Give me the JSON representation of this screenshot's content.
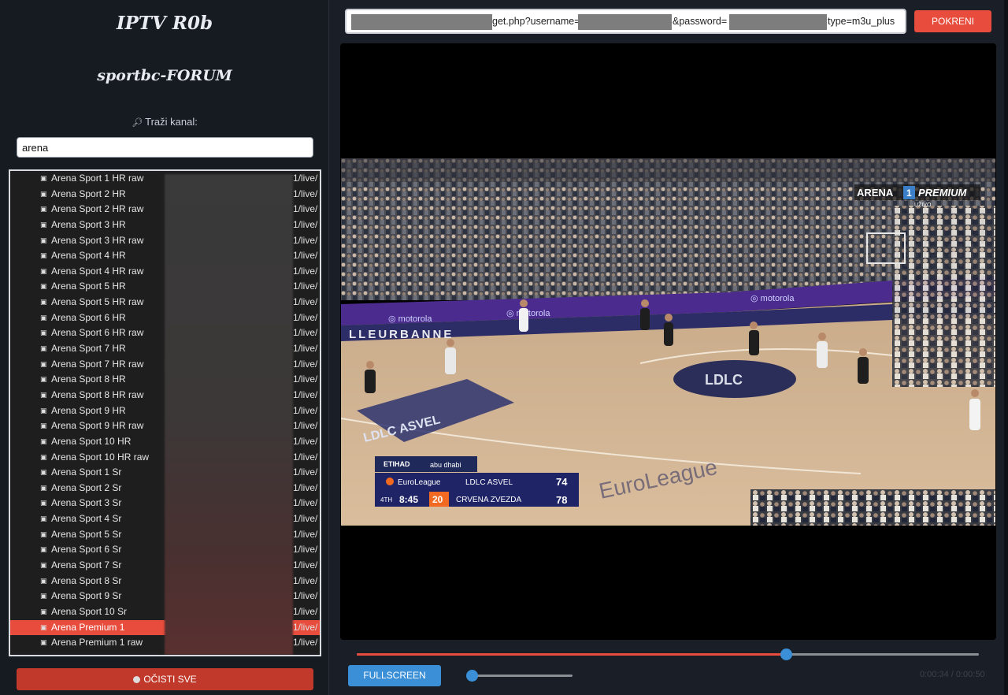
{
  "sidebar": {
    "title": "IPTV R0b",
    "subtitle": "sportbc-FORUM",
    "search_label": "Traži kanal:",
    "search_icon": "magnifier-icon",
    "search_value": "arena",
    "clear_label": "OČISTI SVE",
    "channels": [
      {
        "name": "Arena Sport 1 HR raw",
        "url": "1/live/"
      },
      {
        "name": "Arena Sport 2 HR",
        "url": "1/live/"
      },
      {
        "name": "Arena Sport 2 HR raw",
        "url": "1/live/"
      },
      {
        "name": "Arena Sport 3 HR",
        "url": "1/live/"
      },
      {
        "name": "Arena Sport 3 HR raw",
        "url": "1/live/"
      },
      {
        "name": "Arena Sport 4 HR",
        "url": "1/live/"
      },
      {
        "name": "Arena Sport 4 HR raw",
        "url": "1/live/"
      },
      {
        "name": "Arena Sport 5 HR",
        "url": "1/live/"
      },
      {
        "name": "Arena Sport 5 HR raw",
        "url": "1/live/"
      },
      {
        "name": "Arena Sport 6 HR",
        "url": "1/live/"
      },
      {
        "name": "Arena Sport 6 HR raw",
        "url": "1/live/"
      },
      {
        "name": "Arena Sport 7 HR",
        "url": "1/live/"
      },
      {
        "name": "Arena Sport 7 HR raw",
        "url": "1/live/"
      },
      {
        "name": "Arena Sport 8 HR",
        "url": "1/live/"
      },
      {
        "name": "Arena Sport 8 HR raw",
        "url": "1/live/"
      },
      {
        "name": "Arena Sport 9 HR",
        "url": "1/live/"
      },
      {
        "name": "Arena Sport 9 HR raw",
        "url": "1/live/"
      },
      {
        "name": "Arena Sport 10 HR",
        "url": "1/live/"
      },
      {
        "name": "Arena Sport 10 HR raw",
        "url": "1/live/"
      },
      {
        "name": "Arena Sport 1 Sr",
        "url": "1/live/"
      },
      {
        "name": "Arena Sport 2 Sr",
        "url": "1/live/"
      },
      {
        "name": "Arena Sport 3 Sr",
        "url": "1/live/"
      },
      {
        "name": "Arena Sport 4 Sr",
        "url": "1/live/"
      },
      {
        "name": "Arena Sport 5 Sr",
        "url": "1/live/"
      },
      {
        "name": "Arena Sport 6 Sr",
        "url": "1/live/"
      },
      {
        "name": "Arena Sport 7 Sr",
        "url": "1/live/"
      },
      {
        "name": "Arena Sport 8 Sr",
        "url": "1/live/"
      },
      {
        "name": "Arena Sport 9 Sr",
        "url": "1/live/"
      },
      {
        "name": "Arena Sport 10 Sr",
        "url": "1/live/"
      },
      {
        "name": "Arena Premium 1",
        "url": "1/live/",
        "active": true
      },
      {
        "name": "Arena Premium 1 raw",
        "url": "1/live/"
      }
    ]
  },
  "toolbar": {
    "url_part1": "get.php?username=",
    "url_part2": "&password=",
    "url_part3": "type=m3u_plus",
    "start_label": "POKRENI"
  },
  "player": {
    "channel_logo": "ARENA",
    "channel_number": "1",
    "channel_tier": "PREMIUM",
    "live_label": "UŽIVO",
    "court_banner": "LLEURBANNE",
    "court_logo": "LDLC ASVEL",
    "court_center": "LDLC",
    "floor_brand": "EuroLeague",
    "ad_brand": "motorola",
    "sponsor_1": "ETIHAD",
    "sponsor_1_sub": "ABU DHABI",
    "sponsor_2": "abu dhabi",
    "scoreboard": {
      "league": "EuroLeague",
      "home_team": "LDLC ASVEL",
      "home_score": "74",
      "away_team": "CRVENA ZVEZDA",
      "away_score": "78",
      "quarter": "4TH",
      "clock": "8:45",
      "shot_clock": "20"
    }
  },
  "controls": {
    "fullscreen_label": "FULLSCREEN",
    "progress": 0.69,
    "volume": 0.0,
    "time_display": "0:00:34 / 0:00:50",
    "accent": "#e74c3c",
    "thumb_color": "#3a8fd6"
  }
}
